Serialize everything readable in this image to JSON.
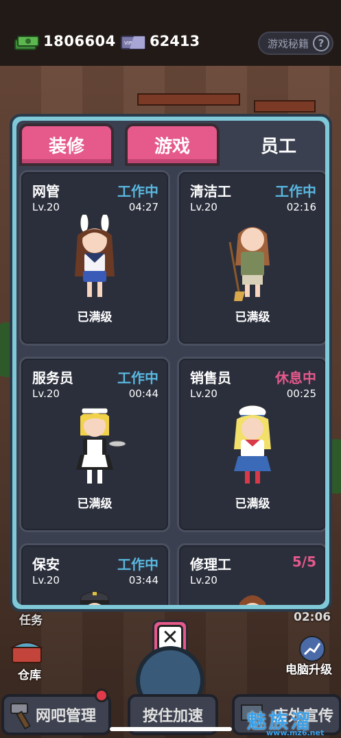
{
  "resources": {
    "cash": "1806604",
    "vip": "62413"
  },
  "cheat_button": {
    "label": "游戏秘籍",
    "help_glyph": "?"
  },
  "tabs": [
    {
      "label": "装修",
      "active": false
    },
    {
      "label": "游戏",
      "active": false
    },
    {
      "label": "员工",
      "active": true
    }
  ],
  "staff": [
    {
      "name": "网管",
      "status": "工作中",
      "level": "Lv.20",
      "time": "04:27",
      "note": "已满级",
      "status_kind": "work"
    },
    {
      "name": "清洁工",
      "status": "工作中",
      "level": "Lv.20",
      "time": "02:16",
      "note": "已满级",
      "status_kind": "work"
    },
    {
      "name": "服务员",
      "status": "工作中",
      "level": "Lv.20",
      "time": "00:44",
      "note": "已满级",
      "status_kind": "work"
    },
    {
      "name": "销售员",
      "status": "休息中",
      "level": "Lv.20",
      "time": "00:25",
      "note": "已满级",
      "status_kind": "rest"
    },
    {
      "name": "保安",
      "status": "工作中",
      "level": "Lv.20",
      "time": "03:44",
      "note": "",
      "status_kind": "work"
    },
    {
      "name": "修理工",
      "status": "5/5",
      "level": "Lv.20",
      "time": "",
      "note": "",
      "status_kind": "rest"
    }
  ],
  "bottom": {
    "task_label": "任务",
    "timer": "02:06",
    "storage_label": "仓库",
    "upgrade_label": "电脑升级",
    "manage_button": "网吧管理",
    "speed_button": "按住加速",
    "promo_button": "店外宣传",
    "close_glyph": "✕"
  },
  "watermark": {
    "text": "魅族溜",
    "url": "www.mz6.net"
  },
  "colors": {
    "accent_pink": "#e5598b",
    "work_blue": "#5ab8e0",
    "panel_frame": "#7fc9d9"
  }
}
